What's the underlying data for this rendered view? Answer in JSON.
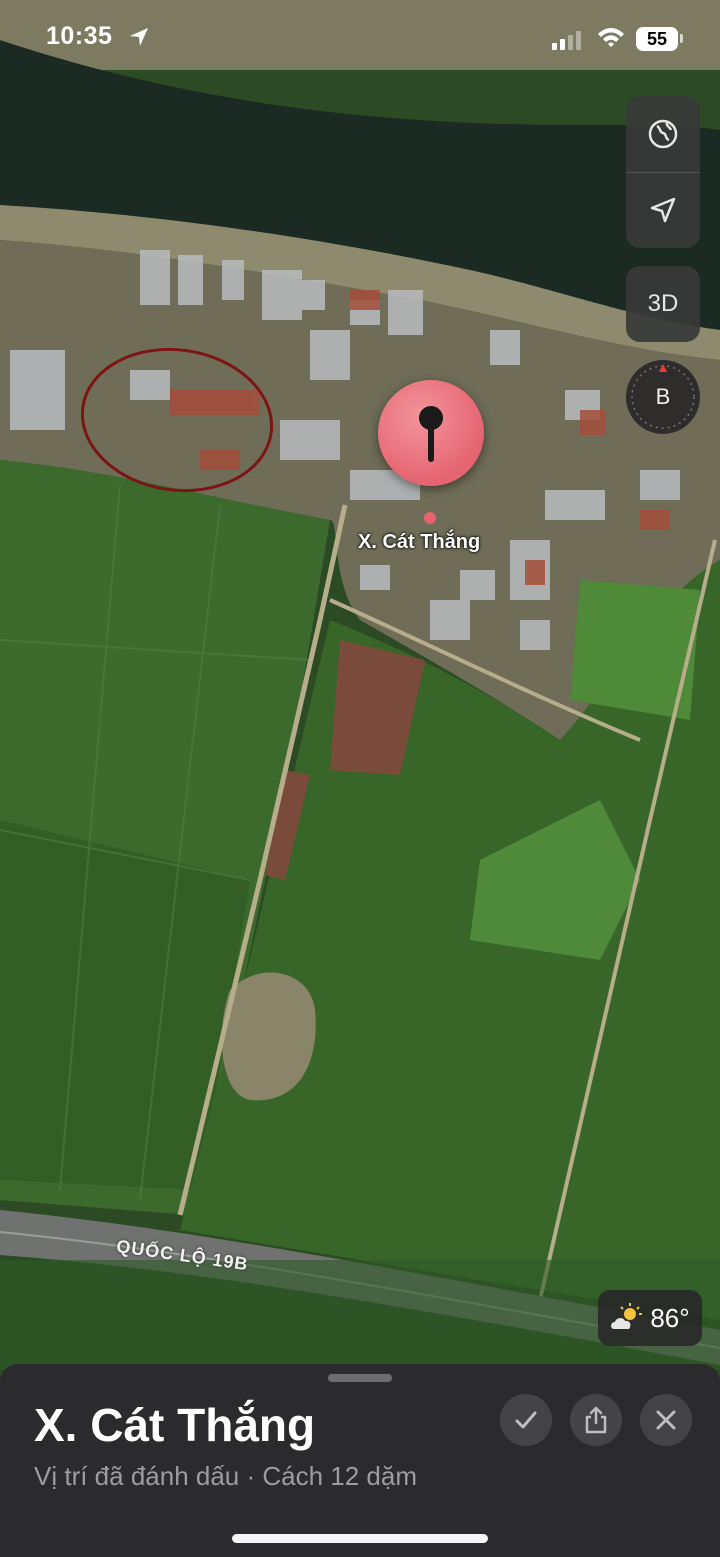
{
  "status_bar": {
    "time": "10:35",
    "battery": "55"
  },
  "map": {
    "pin_label": "X. Cát Thắng",
    "road_label": "QUỐC LỘ 19B",
    "controls": {
      "three_d": "3D",
      "compass": "B"
    },
    "weather": {
      "temp": "86°",
      "icon": "partly-sunny-icon"
    }
  },
  "sheet": {
    "title": "X. Cát Thắng",
    "subtitle": "Vị trí đã đánh dấu · Cách 12 dặm"
  }
}
